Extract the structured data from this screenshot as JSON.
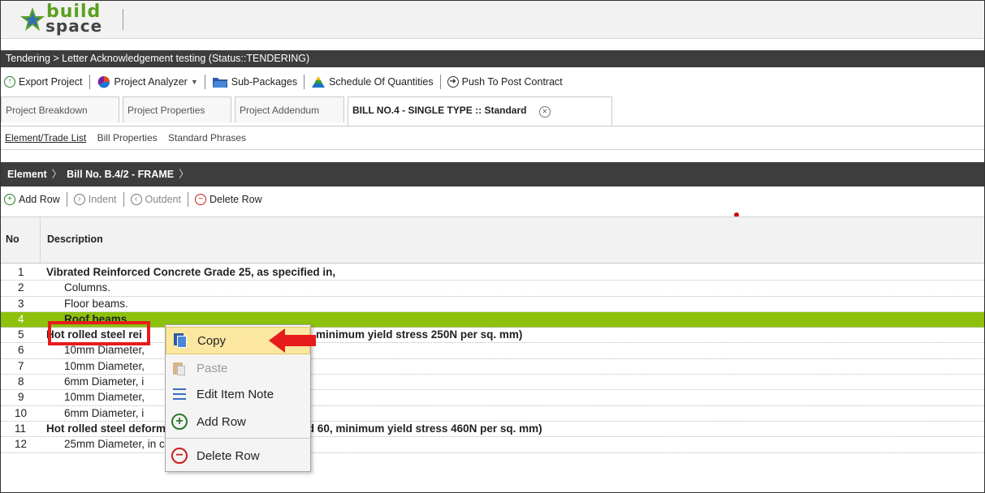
{
  "app": {
    "logo_top": "build",
    "logo_bottom": "space"
  },
  "title_bar": {
    "text": "Tendering > Letter Acknowledgement testing (Status::TENDERING)"
  },
  "toolbar": {
    "export_project": "Export Project",
    "project_analyzer": "Project Analyzer",
    "sub_packages": "Sub-Packages",
    "schedule_of_quantities": "Schedule Of Quantities",
    "push_to_post_contract": "Push To Post Contract"
  },
  "tabs": [
    {
      "label": "Project Breakdown"
    },
    {
      "label": "Project Properties"
    },
    {
      "label": "Project Addendum"
    },
    {
      "label": "BILL NO.4 - SINGLE TYPE :: Standard"
    }
  ],
  "subnav": {
    "element_trade_list": "Element/Trade List",
    "bill_properties": "Bill Properties",
    "standard_phrases": "Standard Phrases"
  },
  "breadcrumb": {
    "root": "Element",
    "current": "Bill No. B.4/2 - FRAME"
  },
  "row_toolbar": {
    "add_row": "Add Row",
    "indent": "Indent",
    "outdent": "Outdent",
    "delete_row": "Delete Row"
  },
  "grid": {
    "col_no": "No",
    "col_description": "Description",
    "rows": [
      {
        "no": "1",
        "desc": "Vibrated Reinforced Concrete Grade 25, as specified in,"
      },
      {
        "no": "2",
        "desc": "Columns."
      },
      {
        "no": "3",
        "desc": "Floor beams."
      },
      {
        "no": "4",
        "desc": "Roof beams"
      },
      {
        "no": "5",
        "desc": "Hot rolled steel rei",
        "desc_tail": "minimum yield stress 250N per sq. mm)"
      },
      {
        "no": "6",
        "desc": "10mm Diameter,"
      },
      {
        "no": "7",
        "desc": "10mm Diameter,"
      },
      {
        "no": "8",
        "desc": "6mm Diameter, i"
      },
      {
        "no": "9",
        "desc": "10mm Diameter,"
      },
      {
        "no": "10",
        "desc": "6mm Diameter, i"
      },
      {
        "no": "11",
        "desc": "Hot rolled steel deformed reinforcement (High Yield 60, minimum yield stress 460N per sq. mm)"
      },
      {
        "no": "12",
        "desc": "25mm Diameter, in column"
      }
    ]
  },
  "context_menu": {
    "copy": "Copy",
    "paste": "Paste",
    "edit_item_note": "Edit Item Note",
    "add_row": "Add Row",
    "delete_row": "Delete Row"
  },
  "colors": {
    "selected_row": "#8dc10b",
    "highlight": "#e61c1c",
    "menu_hover": "#fbe7a0",
    "dark_bar": "#3d3d3d"
  }
}
